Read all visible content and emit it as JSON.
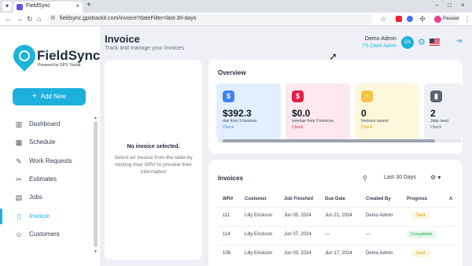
{
  "browser": {
    "tab_title": "FieldSync",
    "tab_close": "×",
    "new_tab": "+",
    "url": "fieldsync.gpstrackit.com/invoice?dateFilter=last-30-days",
    "profile_label": "Paused",
    "win_min": "–",
    "win_max": "□",
    "win_close": "×"
  },
  "brand": {
    "name": "FieldSync",
    "tagline": "Powered by GPS Trackit"
  },
  "sidebar": {
    "add_label": "Add New",
    "items": [
      {
        "label": "Dashboard",
        "icon": "dashboard-icon",
        "glyph": "▥"
      },
      {
        "label": "Schedule",
        "icon": "calendar-icon",
        "glyph": "▦"
      },
      {
        "label": "Work Requests",
        "icon": "wrench-icon",
        "glyph": "✎"
      },
      {
        "label": "Estimates",
        "icon": "paperclip-icon",
        "glyph": "✂"
      },
      {
        "label": "Jobs",
        "icon": "briefcase-icon",
        "glyph": "▤"
      },
      {
        "label": "Invoice",
        "icon": "invoice-icon",
        "glyph": "▯"
      },
      {
        "label": "Customers",
        "icon": "users-icon",
        "glyph": "☺"
      }
    ],
    "active_index": 5
  },
  "header": {
    "title": "Invoice",
    "subtitle": "Track and manage your Invoices",
    "user_name": "Demo Admin",
    "user_role": "FS Client Admin",
    "avatar_initials": "DA"
  },
  "detail": {
    "empty_title": "No invoice selected.",
    "empty_text": "Select an invoice from the table by clicking their WR# to preview their information"
  },
  "overview": {
    "title": "Overview",
    "cards": [
      {
        "value": "$392.3",
        "desc": "due from 3 invoices",
        "link": "Check",
        "bg": "#e3efff",
        "icon_bg": "#3b82f6",
        "link_color": "#3b82f6",
        "glyph": "$"
      },
      {
        "value": "$0.0",
        "desc": "overdue from 0 invoices",
        "link": "Check",
        "bg": "#fde8ef",
        "icon_bg": "#e11d48",
        "link_color": "#e11d48",
        "glyph": "$"
      },
      {
        "value": "0",
        "desc": "Invoices unsent",
        "link": "Check",
        "bg": "#fdf7dc",
        "icon_bg": "#f6c544",
        "link_color": "#c99600",
        "glyph": "◔"
      },
      {
        "value": "2",
        "desc": "Jobs need",
        "link": "Check",
        "bg": "#eef0f4",
        "icon_bg": "#5b6373",
        "link_color": "#5b6373",
        "glyph": "▮"
      }
    ]
  },
  "invoices": {
    "title": "Invoices",
    "filter": "Last 30 Days",
    "columns": [
      "WR#",
      "Customer",
      "Job Finished",
      "Due Date",
      "Created By",
      "Progress",
      "A"
    ],
    "rows": [
      {
        "wr": "111",
        "customer": "Lilly Erickson",
        "finished": "Jun 05, 2024",
        "due": "Jun 21, 2024",
        "created_by": "Demo Admin",
        "progress": "Sent",
        "status": "sent"
      },
      {
        "wr": "114",
        "customer": "Lilly Erickson",
        "finished": "Jun 07, 2024",
        "due": "---",
        "created_by": "---",
        "progress": "Completed",
        "status": "completed"
      },
      {
        "wr": "108",
        "customer": "Lilly Erickson",
        "finished": "Jun 03, 2024",
        "due": "Jun 17, 2024",
        "created_by": "Demo Admin",
        "progress": "Sent",
        "status": "sent"
      }
    ]
  }
}
